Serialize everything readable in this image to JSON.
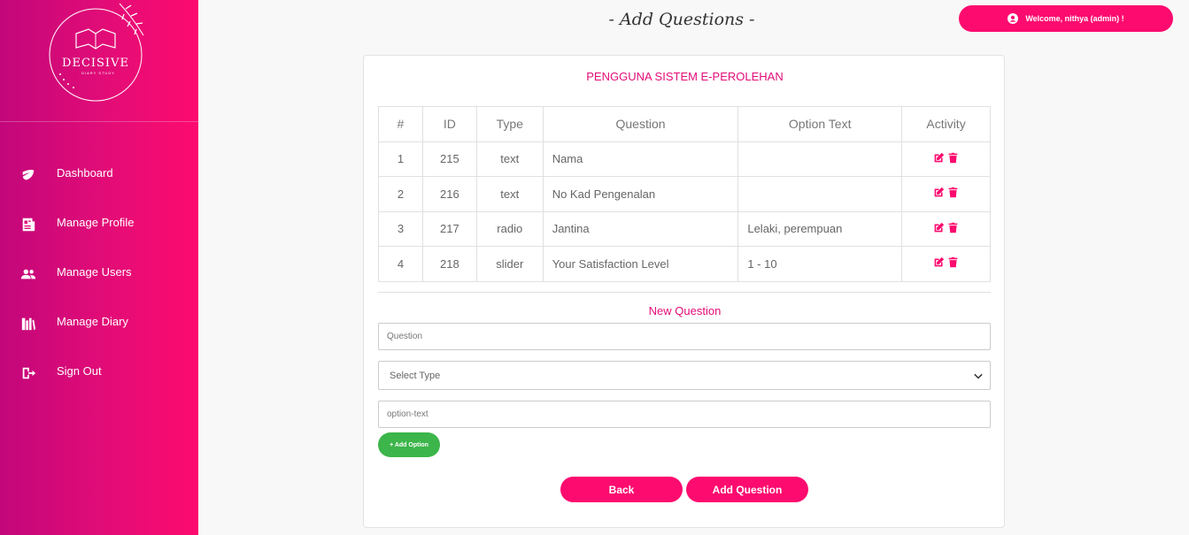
{
  "brand": {
    "name": "DECISIVE",
    "tagline": "DIARY STUDY"
  },
  "colors": {
    "accent": "#fd0b6f",
    "success": "#3cb54a",
    "sidebar_start": "#c2077a"
  },
  "sidebar": {
    "items": [
      {
        "label": "Dashboard",
        "icon": "leaf-icon"
      },
      {
        "label": "Manage Profile",
        "icon": "newspaper-icon"
      },
      {
        "label": "Manage Users",
        "icon": "users-icon"
      },
      {
        "label": "Manage Diary",
        "icon": "books-icon"
      },
      {
        "label": "Sign Out",
        "icon": "sign-out-icon"
      }
    ]
  },
  "header": {
    "title": "- Add Questions -",
    "welcome": "Welcome, nithya (admin) !"
  },
  "card": {
    "title": "PENGGUNA SISTEM E-PEROLEHAN",
    "table": {
      "columns": [
        "#",
        "ID",
        "Type",
        "Question",
        "Option Text",
        "Activity"
      ],
      "rows": [
        {
          "num": "1",
          "id": "215",
          "type": "text",
          "question": "Nama",
          "option_text": ""
        },
        {
          "num": "2",
          "id": "216",
          "type": "text",
          "question": "No Kad Pengenalan",
          "option_text": ""
        },
        {
          "num": "3",
          "id": "217",
          "type": "radio",
          "question": "Jantina",
          "option_text": "Lelaki, perempuan"
        },
        {
          "num": "4",
          "id": "218",
          "type": "slider",
          "question": "Your Satisfaction Level",
          "option_text": "1 - 10"
        }
      ]
    },
    "new_question": {
      "heading": "New Question",
      "question_placeholder": "Question",
      "type_select": "Select Type",
      "option_placeholder": "option-text",
      "add_option_label": "+ Add Option"
    },
    "buttons": {
      "back": "Back",
      "add_question": "Add Question"
    }
  }
}
